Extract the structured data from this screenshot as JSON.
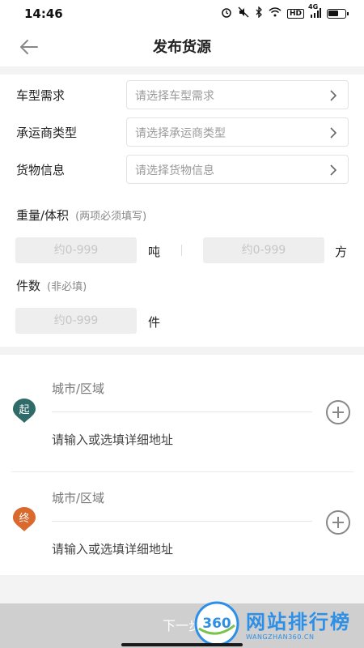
{
  "status_bar": {
    "time": "14:46",
    "network": "4G",
    "hd": "HD"
  },
  "header": {
    "title": "发布货源",
    "back_icon": "arrow-left-icon"
  },
  "form": {
    "rows": [
      {
        "label": "车型需求",
        "placeholder": "请选择车型需求"
      },
      {
        "label": "承运商类型",
        "placeholder": "请选择承运商类型"
      },
      {
        "label": "货物信息",
        "placeholder": "请选择货物信息"
      }
    ],
    "weight_volume": {
      "label": "重量/体积",
      "hint": "(两项必须填写)",
      "weight_placeholder": "约0-999",
      "weight_unit": "吨",
      "volume_placeholder": "约0-999",
      "volume_unit": "方"
    },
    "pieces": {
      "label": "件数",
      "hint": "(非必填)",
      "placeholder": "约0-999",
      "unit": "件"
    }
  },
  "addresses": {
    "start": {
      "marker": "起",
      "color": "#2f6b68",
      "city_placeholder": "城市/区域",
      "detail_placeholder": "请输入或选填详细地址"
    },
    "end": {
      "marker": "终",
      "color": "#d9692c",
      "city_placeholder": "城市/区域",
      "detail_placeholder": "请输入或选填详细地址"
    }
  },
  "footer": {
    "next_label": "下一步"
  },
  "watermark": {
    "logo_text": "360",
    "title": "网站排行榜",
    "subtitle": "WANGZHAN360.CN"
  }
}
